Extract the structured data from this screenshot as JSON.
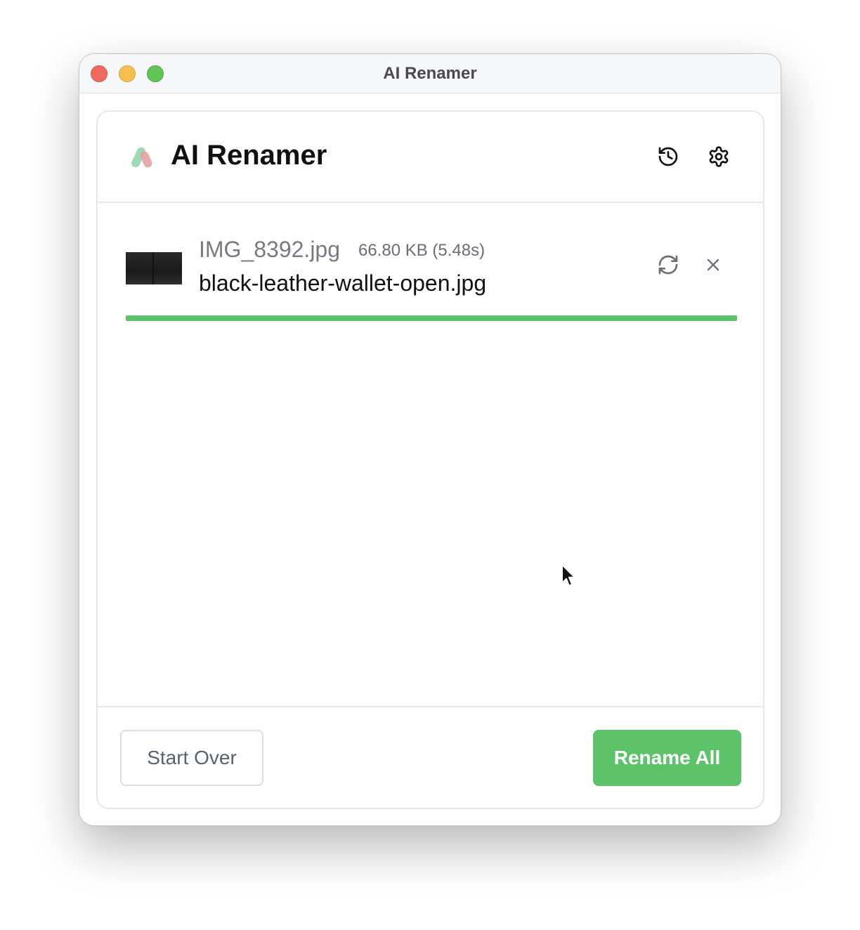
{
  "window": {
    "title": "AI Renamer"
  },
  "header": {
    "app_name": "AI Renamer",
    "history_icon": "history-icon",
    "settings_icon": "gear-icon"
  },
  "file": {
    "original_name": "IMG_8392.jpg",
    "meta": "66.80 KB (5.48s)",
    "new_name": "black-leather-wallet-open.jpg",
    "progress_percent": 100,
    "retry_icon": "refresh-icon",
    "remove_icon": "close-icon"
  },
  "footer": {
    "start_over_label": "Start Over",
    "rename_all_label": "Rename All"
  },
  "colors": {
    "accent": "#5cc369",
    "close": "#ed6a5e",
    "minimize": "#f5bf4f",
    "maximize": "#61c554"
  }
}
